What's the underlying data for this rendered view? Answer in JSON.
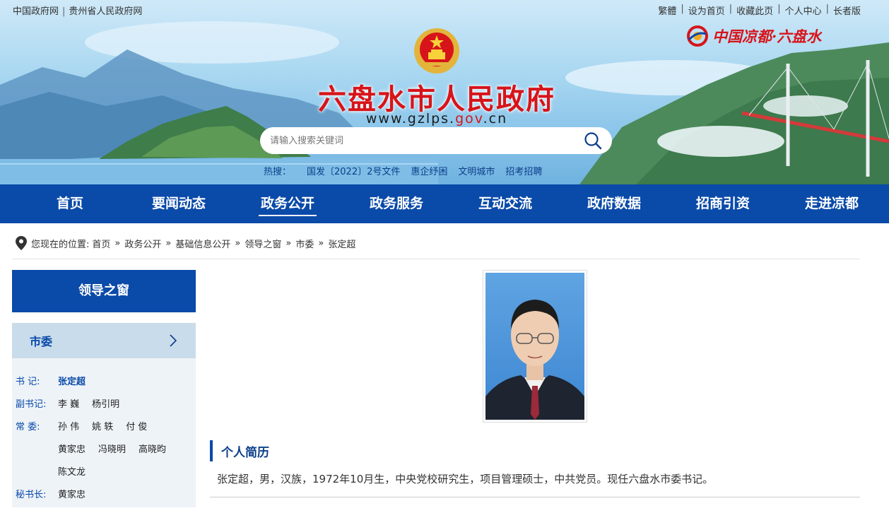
{
  "top_left": {
    "link1": "中国政府网",
    "separator": "|",
    "link2": "贵州省人民政府网"
  },
  "top_right": [
    {
      "label": "繁體"
    },
    {
      "label": "设为首页"
    },
    {
      "label": "收藏此页"
    },
    {
      "label": "个人中心"
    },
    {
      "label": "长者版"
    }
  ],
  "top_right_sep": "|",
  "header": {
    "title": "六盘水市人民政府",
    "url_prefix": "www.gzlps.",
    "url_gov": "gov",
    "url_suffix": ".cn",
    "brand_text": "中国凉都·六盘水"
  },
  "search": {
    "placeholder": "请输入搜索关键词",
    "icon": "search-icon"
  },
  "hot": {
    "label": "热搜：",
    "items": [
      "国发〔2022〕2号文件",
      "惠企纾困",
      "文明城市",
      "招考招聘"
    ]
  },
  "nav": {
    "items": [
      "首页",
      "要闻动态",
      "政务公开",
      "政务服务",
      "互动交流",
      "政府数据",
      "招商引资",
      "走进凉都"
    ],
    "active": "政务公开"
  },
  "breadcrumb": {
    "prefix": "您现在的位置:",
    "raquo": "»",
    "items": [
      "首页",
      "政务公开",
      "基础信息公开",
      "领导之窗",
      "市委",
      "张定超"
    ]
  },
  "sidebar": {
    "heading": "领导之窗",
    "category": "市委",
    "rows": [
      {
        "role": "书  记:",
        "names": [
          "张定超"
        ]
      },
      {
        "role": "副书记:",
        "names": [
          "李  巍",
          "杨引明"
        ]
      },
      {
        "role": "常  委:",
        "names": [
          "孙 伟",
          "姚 轶",
          "付 俊"
        ]
      },
      {
        "role": "",
        "names": [
          "黄家忠",
          "冯晓明",
          "高晓昀"
        ]
      },
      {
        "role": "",
        "names": [
          "陈文龙"
        ]
      },
      {
        "role": "秘书长:",
        "names": [
          "黄家忠"
        ]
      }
    ],
    "current": "张定超"
  },
  "main": {
    "section_title": "个人简历",
    "bio": "张定超，男，汉族，1972年10月生，中央党校研究生，项目管理硕士，中共党员。现任六盘水市委书记。"
  },
  "colors": {
    "primary": "#0a4aa8",
    "title_red": "#d7141a",
    "side_bg": "#eef3f8",
    "cat_bg": "#c9dceb"
  }
}
